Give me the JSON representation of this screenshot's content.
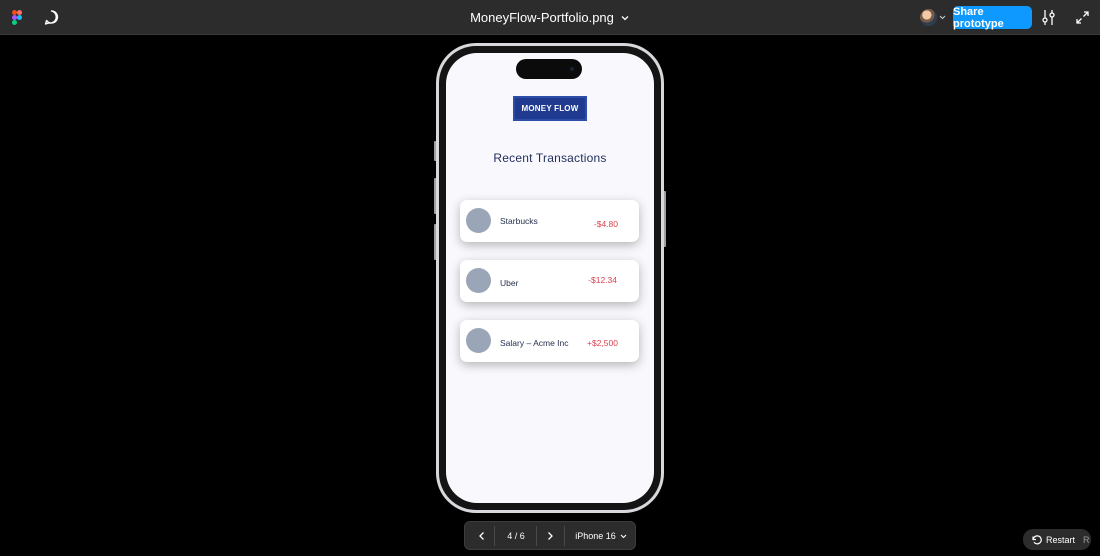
{
  "topbar": {
    "file_title": "MoneyFlow-Portfolio.png",
    "share_label": "Share prototype"
  },
  "app": {
    "brand": "MONEY FLOW",
    "title": "Recent Transactions",
    "transactions": [
      {
        "name": "Starbucks",
        "amount": "-$4.80"
      },
      {
        "name": "Uber",
        "amount": "-$12.34"
      },
      {
        "name": "Salary – Acme Inc",
        "amount": "+$2,500"
      }
    ]
  },
  "pager": {
    "count": "4 / 6",
    "device": "iPhone 16"
  },
  "restart": {
    "label": "Restart",
    "shortcut": "R"
  },
  "colors": {
    "accent": "#0d99ff",
    "brand": "#1f3a8f",
    "amount": "#d9414f"
  }
}
